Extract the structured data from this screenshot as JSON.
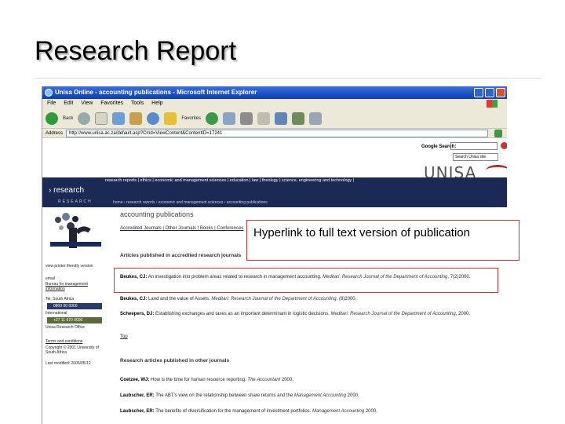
{
  "slide": {
    "title": "Research Report"
  },
  "browser": {
    "title": "Unisa Online - accounting publications - Microsoft Internet Explorer",
    "menu": [
      "File",
      "Edit",
      "View",
      "Favorites",
      "Tools",
      "Help"
    ],
    "toolbar_back": "Back",
    "toolbar_favorites": "Favorites",
    "address_label": "Address",
    "address_url": "http://www.unisa.ac.za/default.asp?Cmd=ViewContent&ContentID=17241"
  },
  "site": {
    "search_label": "Google Search:",
    "search_scope": "Search Unisa site",
    "brand": "UNISA",
    "research_label": "› research",
    "research_sub": "RESEARCH",
    "nav_links": "research reports | ethics | economic and management sciences | education | law | theology | science, engineering and technology |",
    "breadcrumb": "home › research reports › economic and management sciences › accounting publications"
  },
  "sidebar": {
    "printer": "view printer friendly version",
    "email_label": "email",
    "email_link": "Bureau for management information",
    "tel_label": "Tel: South Africa",
    "phone_sa": "0800 00 0000",
    "tel_intl": "International",
    "phone_intl": "+27 11 670 9000",
    "office": "Unisa Research Office",
    "terms": "Terms and conditions",
    "copyright": "Copyright © 2001 University of South Africa",
    "modified": "Last modified: 2005/05/12"
  },
  "main": {
    "heading": "accounting publications",
    "subnav": "Accredited Journals | Other Journals | Books | Conferences",
    "section1": "Articles published in accredited research journals",
    "entries1": [
      {
        "author": "Beukes, CJ:",
        "text": " An investigation into problem areas related to research in management accounting. ",
        "journal": "Meditari: Research Journal of the Department of Accounting",
        "year": ", 7(2)2000."
      },
      {
        "author": "Beukes, CJ:",
        "text": " Land and the value of Assets. ",
        "journal": "Meditari: Research Journal of the Department of Accounting",
        "year": ", (8)2000."
      },
      {
        "author": "Scheepers, DJ:",
        "text": " Establishing exchanges and taxes as an important determinant in logistic decisions. ",
        "journal": "Meditari: Research Journal of the Department of Accounting",
        "year": ", 2000."
      }
    ],
    "top_link": "Top",
    "section2": "Research articles published in other journals",
    "entries2": [
      {
        "author": "Coetzee, WJ:",
        "text": " How is the time for human resource reporting. ",
        "journal": "The Accountant",
        "year": " 2000."
      },
      {
        "author": "Laubscher, ER:",
        "text": " The ABT's view on the relationship between share returns and the ",
        "journal": "Management Accounting",
        "year": " 2000."
      },
      {
        "author": "Laubscher, ER:",
        "text": " The benefits of diversification for the management of investment portfolios. ",
        "journal": "Management Accounting",
        "year": " 2000."
      }
    ]
  },
  "annotation": {
    "callout": "Hyperlink to full text version of publication"
  },
  "colors": {
    "nav": "#1a2a55",
    "ie_title": "#0b3fb0",
    "callout_border": "#cc3333"
  }
}
